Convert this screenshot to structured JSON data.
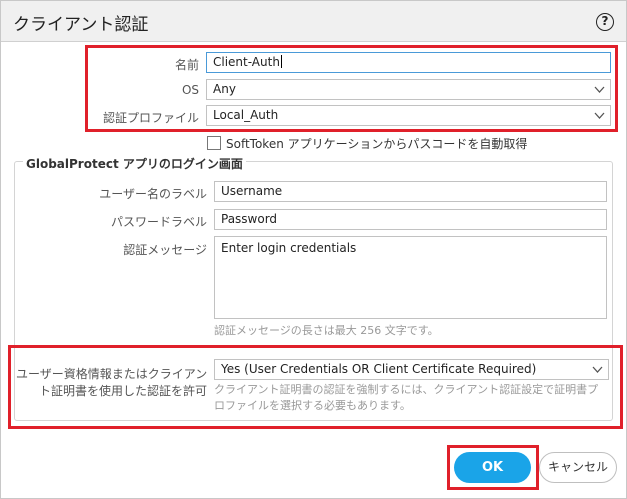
{
  "dialog": {
    "title": "クライアント認証",
    "help_glyph": "?"
  },
  "form": {
    "name_label": "名前",
    "name_value": "Client-Auth",
    "os_label": "OS",
    "os_value": "Any",
    "auth_profile_label": "認証プロファイル",
    "auth_profile_value": "Local_Auth",
    "softtoken_label": "SoftToken アプリケーションからパスコードを自動取得"
  },
  "login_screen": {
    "legend": "GlobalProtect アプリのログイン画面",
    "username_label_label": "ユーザー名のラベル",
    "username_label_value": "Username",
    "password_label_label": "パスワードラベル",
    "password_label_value": "Password",
    "auth_message_label": "認証メッセージ",
    "auth_message_value": "Enter login credentials",
    "auth_message_hint": "認証メッセージの長さは最大 256 文字です。"
  },
  "credential": {
    "label_line1": "ユーザー資格情報またはクライアン",
    "label_line2": "ト証明書を使用した認証を許可",
    "value": "Yes (User Credentials OR Client Certificate Required)",
    "hint": "クライアント証明書の認証を強制するには、クライアント認証設定で証明書プロファイルを選択する必要もあります。"
  },
  "buttons": {
    "ok": "OK",
    "cancel": "キャンセル"
  },
  "colors": {
    "highlight": "#e0202a",
    "accent": "#1aa4e8"
  }
}
